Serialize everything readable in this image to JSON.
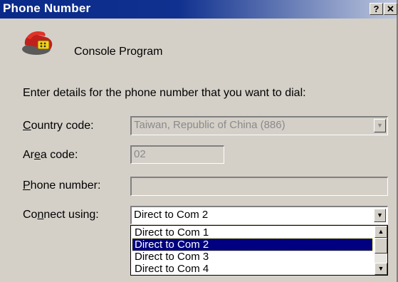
{
  "window": {
    "title": "Phone Number",
    "help_glyph": "?",
    "close_glyph": "✕"
  },
  "header": {
    "icon": "telephone-icon",
    "program_name": "Console Program"
  },
  "instructions": "Enter details for the phone number that you want to dial:",
  "country_code": {
    "label_pre": "",
    "label_ul": "C",
    "label_post": "ountry code:",
    "value": "Taiwan, Republic of China (886)"
  },
  "area_code": {
    "label_pre": "Ar",
    "label_ul": "e",
    "label_post": "a code:",
    "value": "02"
  },
  "phone_number": {
    "label_pre": "",
    "label_ul": "P",
    "label_post": "hone number:",
    "value": ""
  },
  "connect_using": {
    "label_pre": "Co",
    "label_ul": "n",
    "label_post": "nect using:",
    "value": "Direct to Com 2",
    "options": [
      "Direct to Com 1",
      "Direct to Com 2",
      "Direct to Com 3",
      "Direct to Com 4"
    ],
    "selected_index": 1
  },
  "glyphs": {
    "down_arrow": "▼",
    "up_arrow": "▲"
  }
}
